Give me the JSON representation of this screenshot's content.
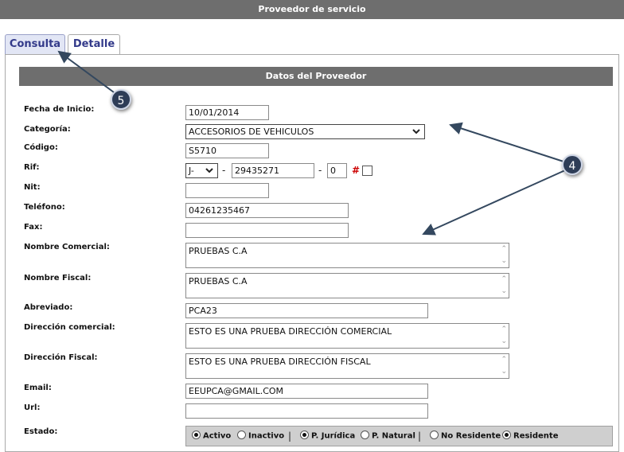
{
  "window": {
    "title": "Proveedor de servicio"
  },
  "tabs": [
    {
      "label": "Consulta",
      "active": true
    },
    {
      "label": "Detalle",
      "active": false
    }
  ],
  "section": {
    "title": "Datos del Proveedor"
  },
  "form": {
    "fecha_inicio": {
      "label": "Fecha de Inicio:",
      "value": "10/01/2014"
    },
    "categoria": {
      "label": "Categoría:",
      "value": "ACCESORIOS DE VEHICULOS"
    },
    "codigo": {
      "label": "Código:",
      "value": "S5710"
    },
    "rif": {
      "label": "Rif:",
      "prefix": "J-",
      "number": "29435271",
      "check": "0",
      "hash": "#"
    },
    "nit": {
      "label": "Nit:",
      "value": ""
    },
    "telefono": {
      "label": "Teléfono:",
      "value": "04261235467"
    },
    "fax": {
      "label": "Fax:",
      "value": ""
    },
    "nombre_comercial": {
      "label": "Nombre Comercial:",
      "value": "PRUEBAS C.A"
    },
    "nombre_fiscal": {
      "label": "Nombre Fiscal:",
      "value": "PRUEBAS C.A"
    },
    "abreviado": {
      "label": "Abreviado:",
      "value": "PCA23"
    },
    "direccion_comercial": {
      "label": "Dirección comercial:",
      "value": "ESTO ES UNA PRUEBA DIRECCIÓN COMERCIAL"
    },
    "direccion_fiscal": {
      "label": "Dirección Fiscal:",
      "value": "ESTO ES UNA PRUEBA DIRECCIÓN FISCAL"
    },
    "email": {
      "label": "Email:",
      "value": "EEUPCA@GMAIL.COM"
    },
    "url": {
      "label": "Url:",
      "value": ""
    },
    "estado": {
      "label": "Estado:",
      "options": [
        {
          "label": "Activo",
          "checked": true
        },
        {
          "label": "Inactivo",
          "checked": false
        },
        {
          "label": "P. Jurídica",
          "checked": true
        },
        {
          "label": "P. Natural",
          "checked": false
        },
        {
          "label": "No Residente",
          "checked": false
        },
        {
          "label": "Residente",
          "checked": true
        }
      ],
      "separator": "|"
    }
  },
  "callouts": [
    {
      "number": "5"
    },
    {
      "number": "4"
    }
  ],
  "icons": {
    "dropdown": "chevron-down-icon",
    "scroll": "scroll-arrows-icon"
  },
  "colors": {
    "header_bg": "#6e6e6e",
    "tab_active_bg": "#e2e6f5",
    "callout_bg": "#2e3d57",
    "estado_bg": "#cfcfcf",
    "hash": "#cc0000"
  }
}
